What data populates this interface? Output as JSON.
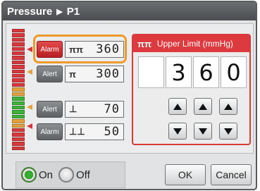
{
  "header": {
    "title": "Pressure",
    "separator": "▶",
    "channel": "P1"
  },
  "alarms": [
    {
      "tag": "Alarm",
      "symbol": "ππ",
      "value": "360",
      "active": true
    },
    {
      "tag": "Alert",
      "symbol": "π",
      "value": "300",
      "active": false
    },
    {
      "tag": "Alert",
      "symbol": "⊥",
      "value": "70",
      "active": false
    },
    {
      "tag": "Alarm",
      "symbol": "⊥⊥",
      "value": "50",
      "active": false
    }
  ],
  "upper_limit": {
    "symbol": "ππ",
    "title": "Upper Limit (mmHg)",
    "digits": [
      "3",
      "6",
      "0"
    ]
  },
  "toggle": {
    "on_label": "On",
    "off_label": "Off",
    "selected": "on"
  },
  "buttons": {
    "ok": "OK",
    "cancel": "Cancel"
  },
  "colors": {
    "alarm": "#dc3a3f",
    "highlight": "#ee9a2a",
    "on": "#35b12e"
  }
}
